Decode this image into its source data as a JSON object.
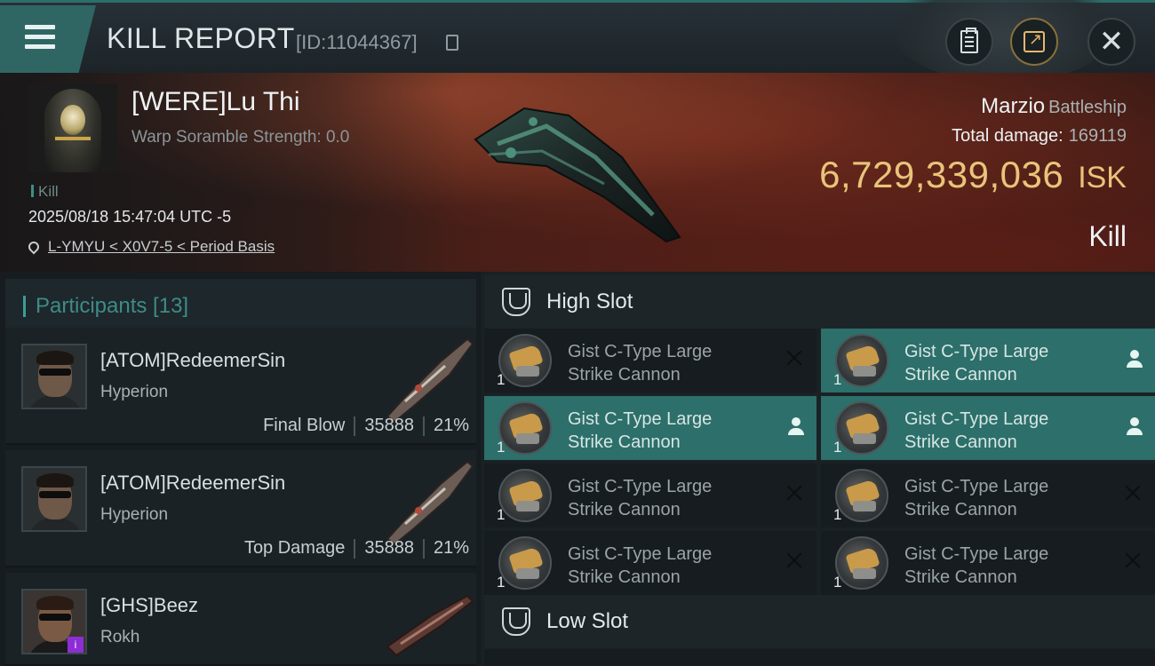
{
  "header": {
    "title": "KILL REPORT",
    "report_id": "[ID:11044367]",
    "icons": {
      "menu": "menu-icon",
      "copy": "copy-icon",
      "clipboard": "clipboard-icon",
      "share": "share-icon",
      "close": "close-icon"
    }
  },
  "victim": {
    "name": "[WERE]Lu Thi",
    "warp_scramble": "Warp Soramble Strength: 0.0",
    "tag": "Kill",
    "datetime": "2025/08/18 15:47:04 UTC -5",
    "location": "L-YMYU < X0V7-5 < Period Basis",
    "ship_name": "Marzio",
    "ship_class": "Battleship",
    "total_damage_label": "Total damage:",
    "total_damage": "169119",
    "isk_value": "6,729,339,036",
    "isk_unit": "ISK",
    "result": "Kill"
  },
  "participants": {
    "label": "Participants [13]",
    "items": [
      {
        "name": "[ATOM]RedeemerSin",
        "ship": "Hyperion",
        "role": "Final Blow",
        "damage": "35888",
        "percent": "21%"
      },
      {
        "name": "[ATOM]RedeemerSin",
        "ship": "Hyperion",
        "role": "Top Damage",
        "damage": "35888",
        "percent": "21%"
      },
      {
        "name": "[GHS]Beez",
        "ship": "Rokh",
        "role": "",
        "damage": "",
        "percent": "",
        "badge": "i"
      }
    ]
  },
  "high_slot": {
    "label": "High Slot",
    "modules": [
      {
        "line1": "Gist C-Type Large",
        "line2": "Strike Cannon",
        "qty": "1",
        "state": "destroyed"
      },
      {
        "line1": "Gist C-Type Large",
        "line2": "Strike Cannon",
        "qty": "1",
        "state": "dropped"
      },
      {
        "line1": "Gist C-Type Large",
        "line2": "Strike Cannon",
        "qty": "1",
        "state": "dropped"
      },
      {
        "line1": "Gist C-Type Large",
        "line2": "Strike Cannon",
        "qty": "1",
        "state": "dropped"
      },
      {
        "line1": "Gist C-Type Large",
        "line2": "Strike Cannon",
        "qty": "1",
        "state": "destroyed"
      },
      {
        "line1": "Gist C-Type Large",
        "line2": "Strike Cannon",
        "qty": "1",
        "state": "destroyed"
      },
      {
        "line1": "Gist C-Type Large",
        "line2": "Strike Cannon",
        "qty": "1",
        "state": "destroyed"
      },
      {
        "line1": "Gist C-Type Large",
        "line2": "Strike Cannon",
        "qty": "1",
        "state": "destroyed"
      }
    ]
  },
  "low_slot": {
    "label": "Low Slot"
  },
  "colors": {
    "accent": "#2d6f6a",
    "isk": "#e9c47a",
    "hero_bg": "#4a2019"
  }
}
